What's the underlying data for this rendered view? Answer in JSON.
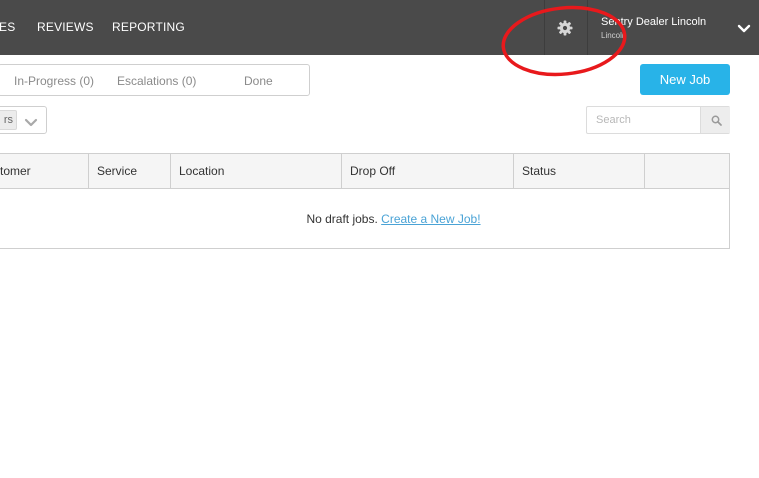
{
  "nav": {
    "items": [
      {
        "label": "ES"
      },
      {
        "label": "REVIEWS"
      },
      {
        "label": "REPORTING"
      }
    ]
  },
  "user": {
    "name": "Sentry Dealer Lincoln",
    "sub": "Lincoln"
  },
  "tabs": [
    {
      "label": "In-Progress (0)"
    },
    {
      "label": "Escalations (0)"
    },
    {
      "label": "Done"
    }
  ],
  "actions": {
    "new_job_label": "New Job"
  },
  "filter": {
    "selected": "rs"
  },
  "search": {
    "placeholder": "Search"
  },
  "table": {
    "columns": [
      "tomer",
      "Service",
      "Location",
      "Drop Off",
      "Status",
      ""
    ],
    "empty_text": "No draft jobs.",
    "empty_link": "Create a New Job!"
  },
  "colors": {
    "topbar": "#4a4a4a",
    "accent": "#28b3e8",
    "annotation": "#e8191c",
    "link": "#4aa3d6"
  },
  "icons": [
    "gear-icon",
    "chevron-down-icon",
    "search-icon"
  ]
}
